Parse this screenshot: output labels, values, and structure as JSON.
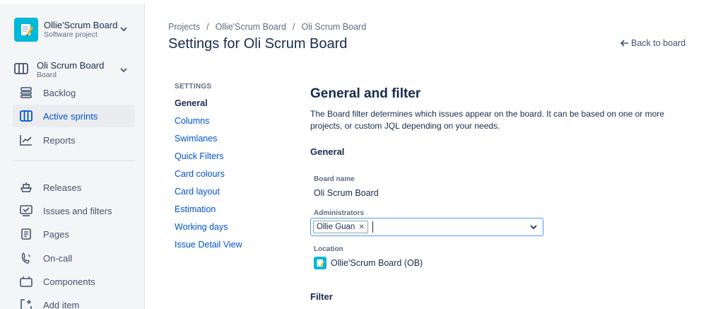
{
  "project": {
    "name": "Ollie'Scrum Board",
    "type": "Software project"
  },
  "board": {
    "name": "Oli Scrum Board",
    "type": "Board"
  },
  "nav": {
    "backlog": "Backlog",
    "active_sprints": "Active sprints",
    "reports": "Reports",
    "releases": "Releases",
    "issues_filters": "Issues and filters",
    "pages": "Pages",
    "on_call": "On-call",
    "components": "Components",
    "add_item": "Add item"
  },
  "breadcrumbs": [
    "Projects",
    "Ollie'Scrum Board",
    "Oli Scrum Board"
  ],
  "page_title": "Settings for Oli Scrum Board",
  "back_link": "Back to board",
  "settings_menu": {
    "header": "SETTINGS",
    "items": [
      "General",
      "Columns",
      "Swimlanes",
      "Quick Filters",
      "Card colours",
      "Card layout",
      "Estimation",
      "Working days",
      "Issue Detail View"
    ]
  },
  "content": {
    "title": "General and filter",
    "description": "The Board filter determines which issues appear on the board. It can be based on one or more projects, or custom JQL depending on your needs.",
    "general_heading": "General",
    "board_name_label": "Board name",
    "board_name_value": "Oli Scrum Board",
    "administrators_label": "Administrators",
    "administrators": [
      "Ollie Guan"
    ],
    "location_label": "Location",
    "location_value": "Ollie'Scrum Board (OB)",
    "filter_heading": "Filter"
  },
  "colors": {
    "accent": "#0052cc",
    "project_avatar": "#00b8d9",
    "focus_border": "#4c9aff"
  }
}
